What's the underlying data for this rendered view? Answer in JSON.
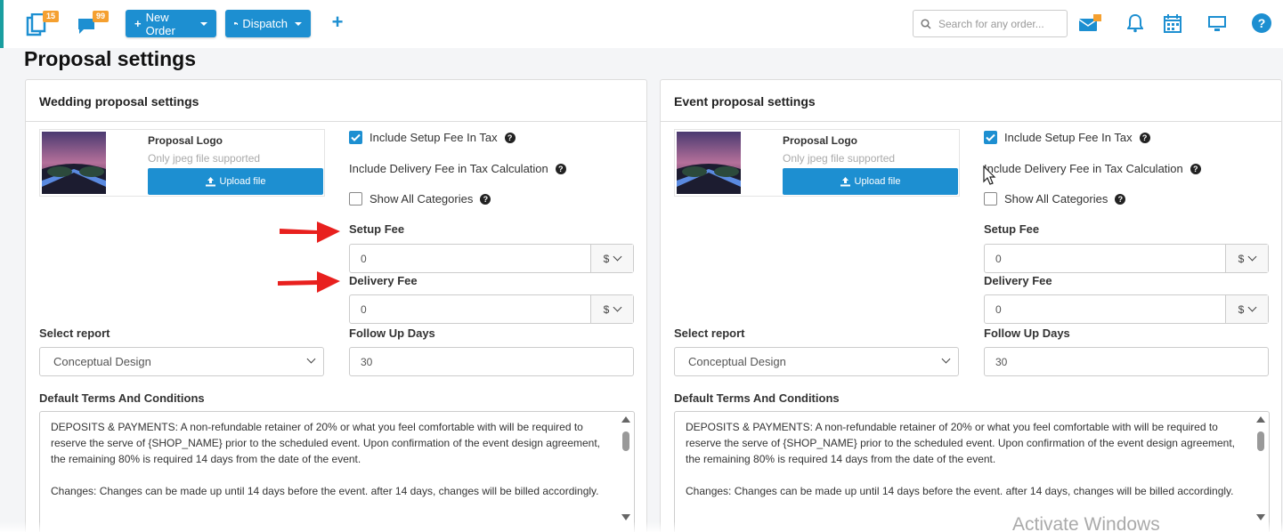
{
  "topbar": {
    "orders_badge": "15",
    "messages_badge": "99",
    "new_order_label": "New Order",
    "dispatch_label": "Dispatch",
    "search_placeholder": "Search for any order..."
  },
  "page_title": "Proposal settings",
  "panels": [
    {
      "title": "Wedding proposal settings",
      "logo_title": "Proposal Logo",
      "logo_sub": "Only jpeg file supported",
      "upload_label": "Upload file",
      "include_setup_tax": "Include Setup Fee In Tax",
      "include_delivery_tax": "Include Delivery Fee in Tax Calculation",
      "show_all_categories": "Show All Categories",
      "setup_fee_label": "Setup Fee",
      "setup_fee_value": "0",
      "setup_fee_unit": "$",
      "delivery_fee_label": "Delivery Fee",
      "delivery_fee_value": "0",
      "delivery_fee_unit": "$",
      "select_report_label": "Select report",
      "select_report_value": "Conceptual Design",
      "follow_up_label": "Follow Up Days",
      "follow_up_value": "30",
      "terms_label": "Default Terms And Conditions",
      "terms_p1": "DEPOSITS & PAYMENTS:  A non-refundable retainer of 20% or what you feel comfortable with will be required to reserve the serve of {SHOP_NAME} prior to the scheduled event. Upon confirmation of the event design agreement, the remaining 80% is required 14 days from the date of the event.",
      "terms_p2": "Changes:  Changes can be made up until 14 days before the event. after 14 days, changes will be billed accordingly."
    },
    {
      "title": "Event proposal settings",
      "logo_title": "Proposal Logo",
      "logo_sub": "Only jpeg file supported",
      "upload_label": "Upload file",
      "include_setup_tax": "Include Setup Fee In Tax",
      "include_delivery_tax": "Include Delivery Fee in Tax Calculation",
      "show_all_categories": "Show All Categories",
      "setup_fee_label": "Setup Fee",
      "setup_fee_value": "0",
      "setup_fee_unit": "$",
      "delivery_fee_label": "Delivery Fee",
      "delivery_fee_value": "0",
      "delivery_fee_unit": "$",
      "select_report_label": "Select report",
      "select_report_value": "Conceptual Design",
      "follow_up_label": "Follow Up Days",
      "follow_up_value": "30",
      "terms_label": "Default Terms And Conditions",
      "terms_p1": "DEPOSITS & PAYMENTS:  A non-refundable retainer of 20% or what you feel comfortable with will be required to reserve the serve of {SHOP_NAME} prior to the scheduled event. Upon confirmation of the event design agreement, the remaining 80% is required 14 days from the date of the event.",
      "terms_p2": "Changes:  Changes can be made up until 14 days before the event. after 14 days, changes will be billed accordingly."
    }
  ],
  "watermark": "Activate Windows",
  "colors": {
    "accent": "#1d8fd1",
    "badge": "#f5a030",
    "arrow": "#e8201e"
  }
}
